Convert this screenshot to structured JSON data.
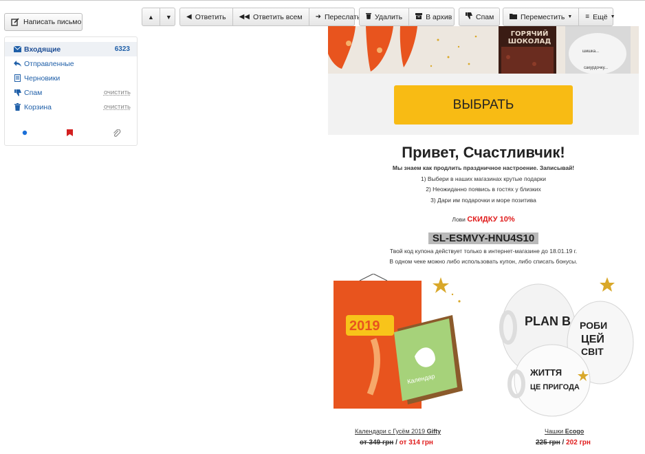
{
  "compose_label": "Написать письмо",
  "folders": [
    {
      "label": "Входящие",
      "count": "6323"
    },
    {
      "label": "Отправленные"
    },
    {
      "label": "Черновики"
    },
    {
      "label": "Спам",
      "action": "очистить"
    },
    {
      "label": "Корзина",
      "action": "очистить"
    }
  ],
  "toolbar": {
    "reply": "Ответить",
    "reply_all": "Ответить всем",
    "forward": "Переслать",
    "delete": "Удалить",
    "archive": "В архив",
    "spam": "Спам",
    "move": "Переместить",
    "more": "Ещё"
  },
  "email": {
    "hero_text": "ГОРЯЧИЙ ШОКОЛАД",
    "choose_button": "ВЫБРАТЬ",
    "greeting": "Привет, Счастливчик!",
    "intro": "Мы знаем как продлить праздничное настроение. Записывай!",
    "steps": [
      "1) Выбери в наших магазинах крутые подарки",
      "2) Неожиданно появись в гостях у близких",
      "3) Дари им подарочки и море позитива"
    ],
    "promo_prefix": "Лови",
    "promo_highlight": "СКИДКУ 10%",
    "coupon_code": "SL-ESMVY-HNU4S10",
    "coupon_note_1": "Твой код купона действует только в интернет-магазине до 18.01.19 г.",
    "coupon_note_2": "В одном чеке можно либо использовать купон, либо списать бонусы.",
    "products": [
      {
        "caption_prefix": "Календари с Гусём 2019",
        "caption_brand": "Gifty",
        "old_price": "от 349 грн",
        "sep": " / ",
        "new_price": "от 314 грн"
      },
      {
        "caption_prefix": "Чашки",
        "caption_brand": "Ecogo",
        "old_price": "225 грн",
        "sep": " / ",
        "new_price": "202 грн"
      }
    ]
  }
}
